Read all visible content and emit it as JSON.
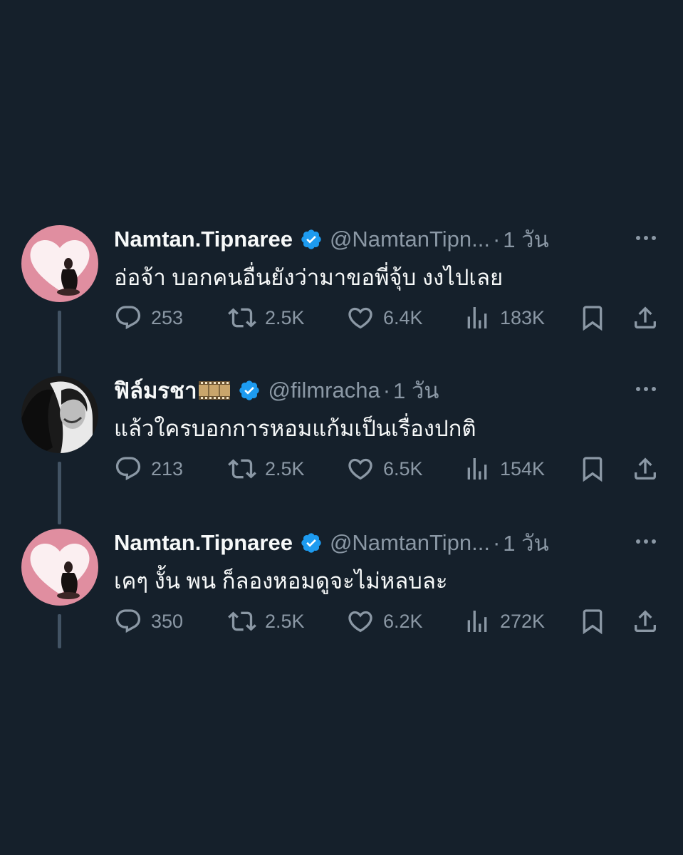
{
  "colors": {
    "background": "#15202b",
    "text": "#f7f9f9",
    "secondary": "#8b98a5",
    "verified": "#1d9bf0",
    "thread_line": "#425364"
  },
  "tweets": [
    {
      "display_name": "Namtan.Tipnaree",
      "handle": "@NamtanTipn...",
      "separator": "·",
      "time": "1 วัน",
      "text": "อ่อจ้า บอกคนอื่นยังว่ามาขอพี่จุ้บ งงไปเลย",
      "replies": "253",
      "reposts": "2.5K",
      "likes": "6.4K",
      "views": "183K",
      "avatar_icon": "heart-portrait-avatar"
    },
    {
      "display_name": "ฟิล์มรชา",
      "handle": "@filmracha",
      "separator": "·",
      "time": "1 วัน",
      "text": "แล้วใครบอกการหอมแก้มเป็นเรื่องปกติ",
      "replies": "213",
      "reposts": "2.5K",
      "likes": "6.5K",
      "views": "154K",
      "name_emoji": "film-frames-icon",
      "avatar_icon": "bw-portrait-avatar"
    },
    {
      "display_name": "Namtan.Tipnaree",
      "handle": "@NamtanTipn...",
      "separator": "·",
      "time": "1 วัน",
      "text": "เคๆ งั้น พน ก็ลองหอมดูจะไม่หลบละ",
      "replies": "350",
      "reposts": "2.5K",
      "likes": "6.2K",
      "views": "272K",
      "avatar_icon": "heart-portrait-avatar"
    }
  ]
}
